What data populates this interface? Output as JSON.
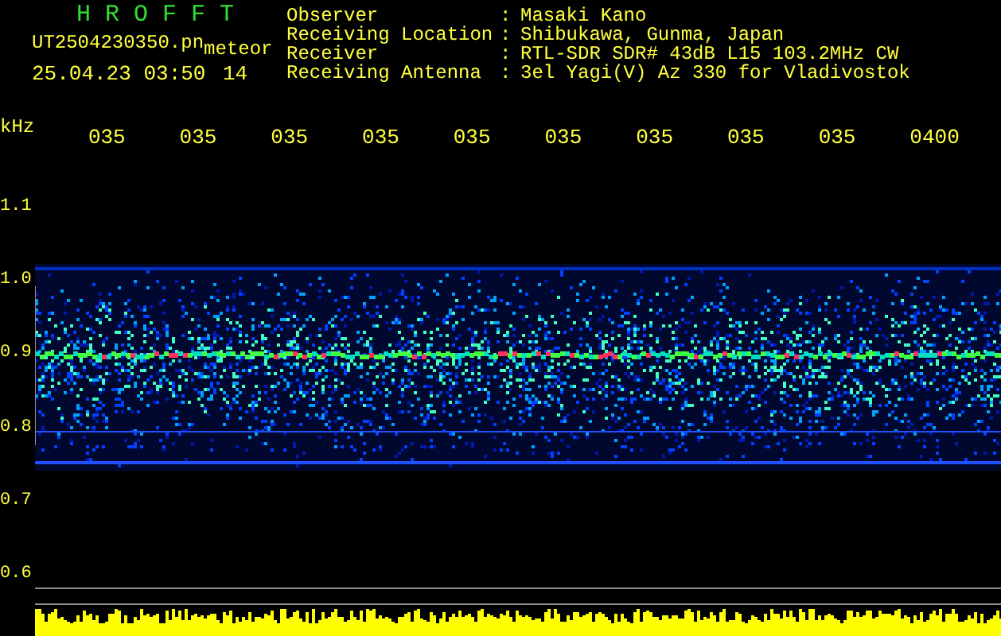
{
  "header": {
    "title": "H R O F F T",
    "file_name": "UT2504230350.pn",
    "file_tag": "meteor",
    "date_time": "25.04.23 03:50",
    "count": "14"
  },
  "info": [
    {
      "label": "Observer",
      "value": "Masaki Kano"
    },
    {
      "label": "Receiving Location",
      "value": "Shibukawa, Gunma, Japan"
    },
    {
      "label": "Receiver",
      "value": "RTL-SDR SDR# 43dB L15 103.2MHz CW"
    },
    {
      "label": "Receiving Antenna",
      "value": "3el Yagi(V) Az 330 for Vladivostok"
    }
  ],
  "separator": ":",
  "time_axis": [
    "035",
    "035",
    "035",
    "035",
    "035",
    "035",
    "035",
    "035",
    "035",
    "0400"
  ],
  "y_axis": {
    "unit": "kHz",
    "labels": [
      "1.1",
      "1.0",
      "0.9",
      "0.8",
      "0.7",
      "0.6"
    ]
  }
}
